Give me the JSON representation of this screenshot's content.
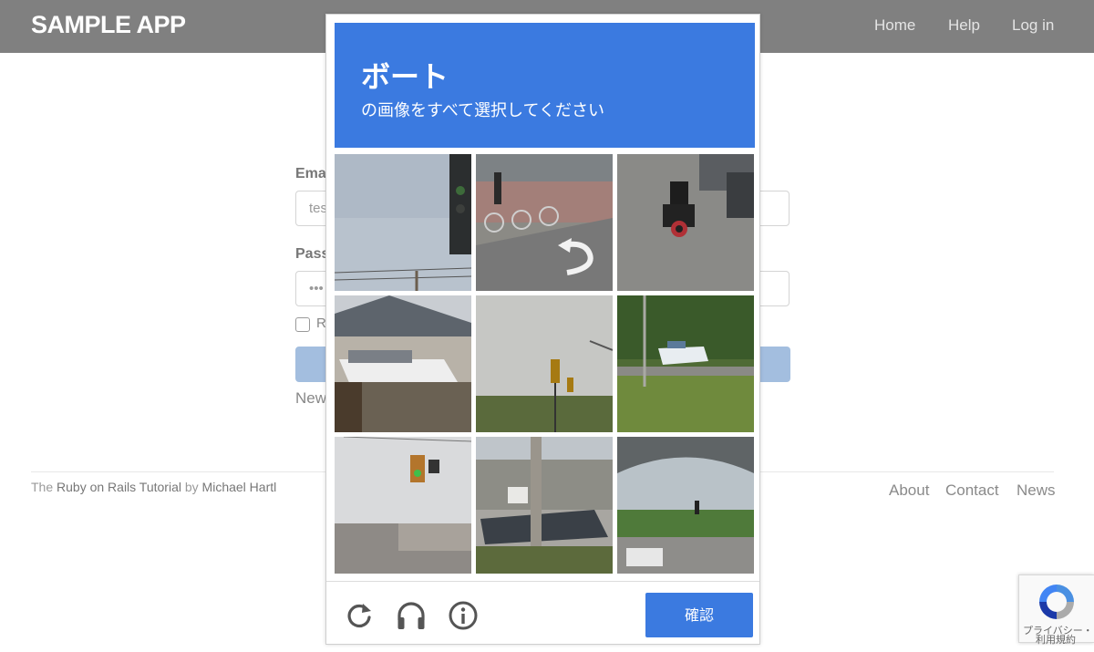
{
  "app": {
    "brand": "SAMPLE APP",
    "nav": [
      "Home",
      "Help",
      "Log in"
    ]
  },
  "form": {
    "email_label": "Ema",
    "email_value": "tes",
    "password_label": "Pass",
    "password_value": "•••",
    "remember_label": "R",
    "signup_text": "New"
  },
  "footer": {
    "prefix": "The ",
    "tutorial_link": "Ruby on Rails Tutorial",
    "by": " by ",
    "author_link": "Michael Hartl",
    "links": [
      "About",
      "Contact",
      "News"
    ]
  },
  "captcha": {
    "title": "ボート",
    "instruction": "の画像をすべて選択してください",
    "tiles": [
      {
        "scene": "traffic-light-pole"
      },
      {
        "scene": "road-bicycles"
      },
      {
        "scene": "scooter-parking"
      },
      {
        "scene": "house-boat"
      },
      {
        "scene": "traffic-signal-sky"
      },
      {
        "scene": "boat-trailer-grass"
      },
      {
        "scene": "traffic-light-street"
      },
      {
        "scene": "bass-boat-trailer"
      },
      {
        "scene": "overpass-intersection"
      }
    ],
    "icons": [
      "reload-icon",
      "audio-icon",
      "info-icon"
    ],
    "verify_label": "確認",
    "accent_color": "#3b7ae0"
  },
  "recaptcha_badge": {
    "privacy": "プライバシー・",
    "terms": "利用規約"
  }
}
